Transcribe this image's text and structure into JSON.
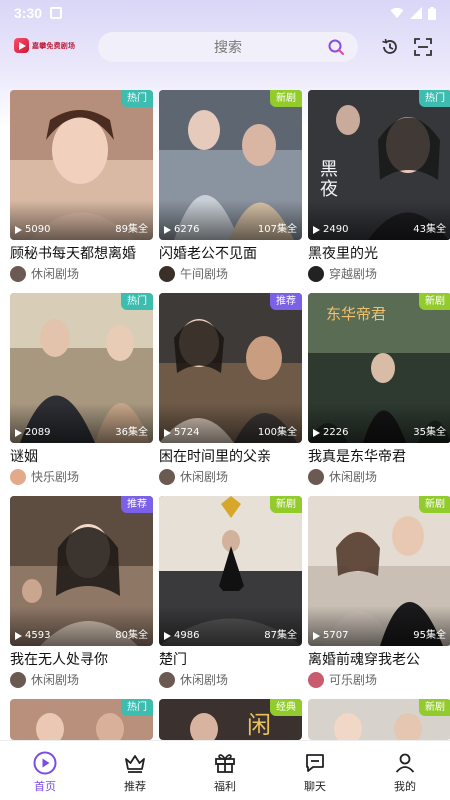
{
  "status_bar": {
    "time": "3:30"
  },
  "header": {
    "logo_text": "嘉攀免费剧场",
    "search_placeholder": "搜索"
  },
  "dramas": [
    {
      "title": "顾秘书每天都想离婚",
      "views": "5090",
      "episodes": "89集全",
      "badge": "热门",
      "source": "休闲剧场"
    },
    {
      "title": "闪婚老公不见面",
      "views": "6276",
      "episodes": "107集全",
      "badge": "新剧",
      "source": "午间剧场"
    },
    {
      "title": "黑夜里的光",
      "views": "2490",
      "episodes": "43集全",
      "badge": "热门",
      "source": "穿越剧场"
    },
    {
      "title": "谜姻",
      "views": "2089",
      "episodes": "36集全",
      "badge": "热门",
      "source": "快乐剧场"
    },
    {
      "title": "困在时间里的父亲",
      "views": "5724",
      "episodes": "100集全",
      "badge": "推荐",
      "source": "休闲剧场"
    },
    {
      "title": "我真是东华帝君",
      "views": "2226",
      "episodes": "35集全",
      "badge": "新剧",
      "source": "休闲剧场"
    },
    {
      "title": "我在无人处寻你",
      "views": "4593",
      "episodes": "80集全",
      "badge": "推荐",
      "source": "休闲剧场"
    },
    {
      "title": "楚门",
      "views": "4986",
      "episodes": "87集全",
      "badge": "新剧",
      "source": "休闲剧场"
    },
    {
      "title": "离婚前魂穿我老公",
      "views": "5707",
      "episodes": "95集全",
      "badge": "新剧",
      "source": "可乐剧场"
    },
    {
      "badge": "热门"
    },
    {
      "badge": "经典"
    },
    {
      "badge": "新剧"
    }
  ],
  "tabs": [
    {
      "label": "首页",
      "icon": "play-circle-icon",
      "active": true
    },
    {
      "label": "推荐",
      "icon": "crown-icon",
      "active": false
    },
    {
      "label": "福利",
      "icon": "gift-icon",
      "active": false
    },
    {
      "label": "聊天",
      "icon": "chat-icon",
      "active": false
    },
    {
      "label": "我的",
      "icon": "person-icon",
      "active": false
    }
  ],
  "colors": {
    "accent": "#7b4de6",
    "badge_hot": "#3dbdb0",
    "badge_new": "#92cc2c",
    "badge_recommend": "#7b61e8"
  }
}
